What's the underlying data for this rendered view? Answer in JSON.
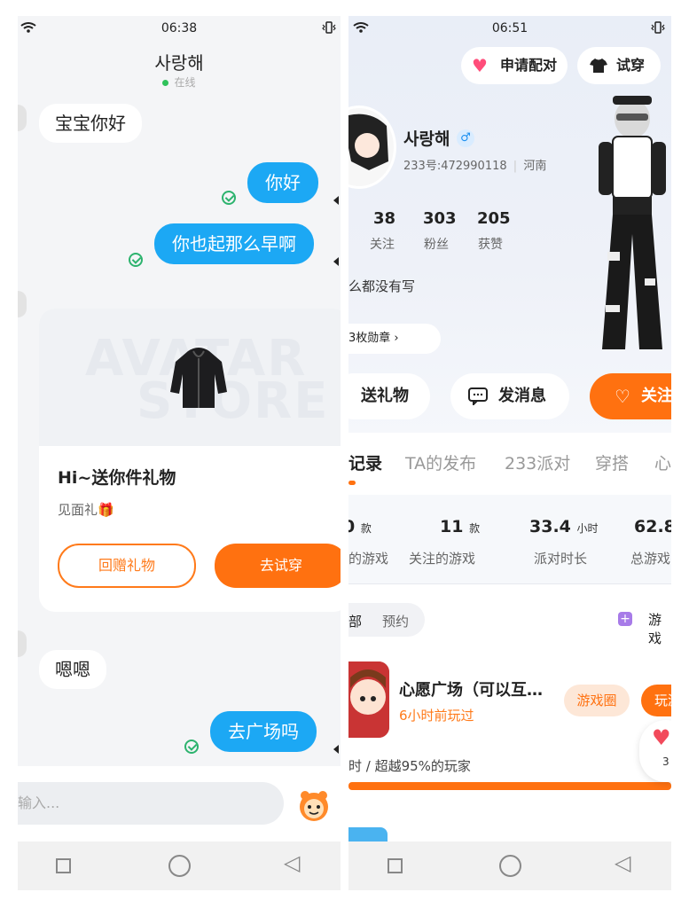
{
  "left": {
    "status_time": "06:38",
    "contact_name": "사랑해",
    "online_text": "在线",
    "messages": [
      {
        "dir": "in",
        "text": "宝宝你好"
      },
      {
        "dir": "out",
        "text": "你好"
      },
      {
        "dir": "out",
        "text": "你也起那么早啊"
      },
      {
        "dir": "in",
        "text": "嗯嗯"
      },
      {
        "dir": "out",
        "text": "去广场吗"
      }
    ],
    "gift_card": {
      "watermark_1": "AVATAR",
      "watermark_2": "STORE",
      "title": "Hi~送你件礼物",
      "subtitle": "见面礼🎁",
      "return_gift_label": "回赠礼物",
      "try_on_label": "去试穿"
    },
    "input_placeholder": "输入...",
    "colors": {
      "outgoing": "#1ca8f4",
      "accent": "#ff7110",
      "read_check": "#2db36e"
    }
  },
  "right": {
    "status_time": "06:51",
    "top_buttons": {
      "match": "申请配对",
      "try_on": "试穿"
    },
    "profile": {
      "name": "사랑해",
      "gender_icon": "male",
      "id_text": "233号:472990118",
      "region": "河南",
      "stats": [
        {
          "value": "38",
          "label": "关注"
        },
        {
          "value": "303",
          "label": "粉丝"
        },
        {
          "value": "205",
          "label": "获赞"
        }
      ],
      "bio": "么都没有写",
      "badges": "3枚勋章 ›"
    },
    "actions": {
      "gift": "送礼物",
      "message": "发消息",
      "follow": "关注"
    },
    "tabs": [
      "记录",
      "TA的发布",
      "233派对",
      "穿搭",
      "心"
    ],
    "game_stats": [
      {
        "num": "0",
        "unit": "款",
        "label": "的游戏"
      },
      {
        "num": "11",
        "unit": "款",
        "label": "关注的游戏"
      },
      {
        "num": "33.4",
        "unit": "小时",
        "label": "派对时长"
      },
      {
        "num": "62.8",
        "unit": "",
        "label": "总游戏"
      }
    ],
    "filters": {
      "all": "部",
      "reserve": "预约",
      "game_btn": "游戏"
    },
    "game_item": {
      "title": "心愿广场（可以互…",
      "last_played": "6小时前玩过",
      "circle_label": "游戏圈",
      "play_label": "玩游",
      "rank_text": "时 / 超越95%的玩家",
      "like_count": "3"
    },
    "colors": {
      "accent": "#ff7110",
      "last_played": "#ff7a1a"
    }
  }
}
